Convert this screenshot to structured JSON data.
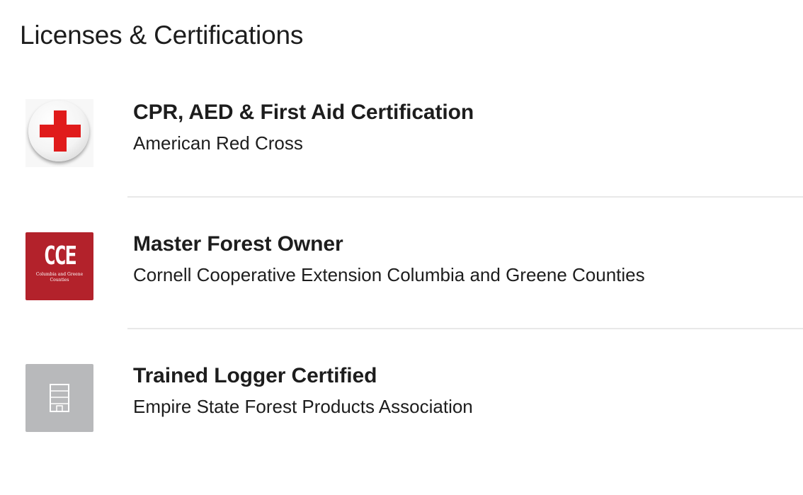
{
  "section": {
    "title": "Licenses & Certifications"
  },
  "certifications": [
    {
      "name": "CPR, AED & First Aid Certification",
      "issuer": "American Red Cross",
      "logo_icon": "red-cross-icon",
      "logo_colors": {
        "cross": "#e01b1b",
        "badge": "#f4f4f4"
      }
    },
    {
      "name": "Master Forest Owner",
      "issuer": "Cornell Cooperative Extension Columbia and Greene Counties",
      "logo_icon": "cce-logo",
      "logo_text": "CCE",
      "logo_subtext": "Columbia and Greene Counties",
      "logo_colors": {
        "background": "#b3222b",
        "text": "#ffffff"
      }
    },
    {
      "name": "Trained Logger Certified",
      "issuer": "Empire State Forest Products Association",
      "logo_icon": "building-icon",
      "logo_colors": {
        "background": "#b8b9bb",
        "icon": "#ffffff"
      }
    }
  ]
}
